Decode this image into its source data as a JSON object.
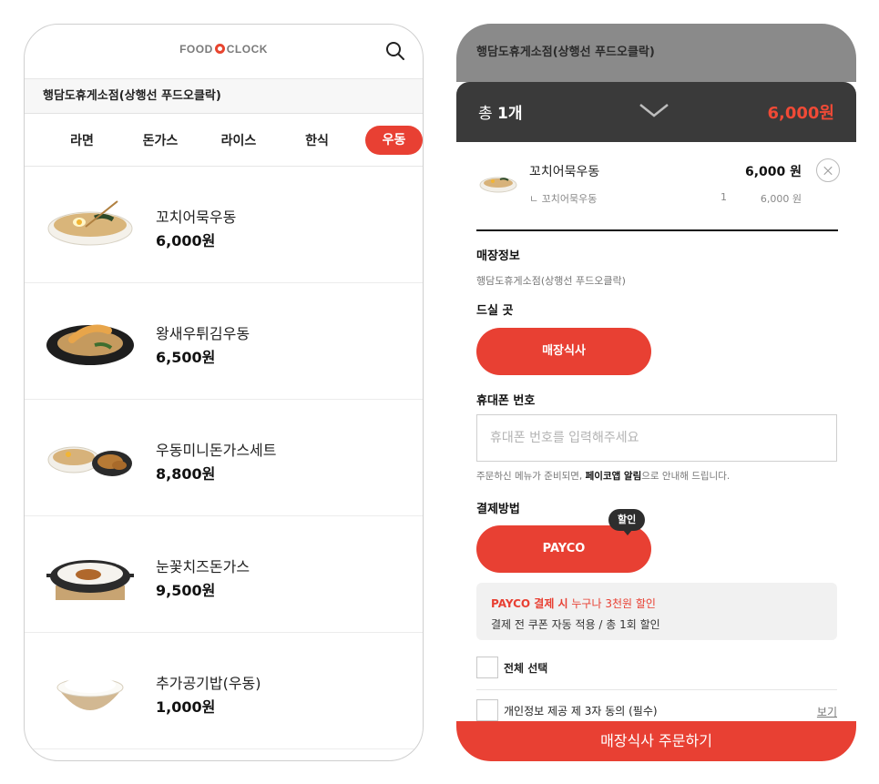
{
  "left": {
    "logo": {
      "left": "FOOD",
      "right": "CLOCK"
    },
    "store_name": "행담도휴게소점(상행선 푸드오클락)",
    "categories": [
      {
        "label": "라면"
      },
      {
        "label": "돈가스"
      },
      {
        "label": "라이스"
      },
      {
        "label": "한식"
      },
      {
        "label": "우동",
        "active": true
      }
    ],
    "menu": [
      {
        "name": "꼬치어묵우동",
        "price": "6,000원"
      },
      {
        "name": "왕새우튀김우동",
        "price": "6,500원"
      },
      {
        "name": "우동미니돈가스세트",
        "price": "8,800원"
      },
      {
        "name": "눈꽃치즈돈가스",
        "price": "9,500원"
      },
      {
        "name": "추가공기밥(우동)",
        "price": "1,000원"
      }
    ]
  },
  "right": {
    "store_name": "행담도휴게소점(상행선 푸드오클락)",
    "sheet": {
      "total_prefix": "총 ",
      "total_count": "1개",
      "total_price": "6,000원"
    },
    "cart_item": {
      "name": "꼬치어묵우동",
      "price": "6,000 원",
      "option": "ㄴ 꼬치어묵우동",
      "qty": "1",
      "option_price": "6,000 원"
    },
    "store_info_label": "매장정보",
    "store_info_value": "행담도휴게소점(상행선 푸드오클락)",
    "dine_label": "드실 곳",
    "dine_button": "매장식사",
    "phone_label": "휴대폰 번호",
    "phone_placeholder": "휴대폰 번호를 입력해주세요",
    "notice_pre": "주문하신 메뉴가 준비되면, ",
    "notice_bold": "페이코앱 알림",
    "notice_post": "으로 안내해 드립니다.",
    "payment_label": "결제방법",
    "payment_badge": "할인",
    "payment_button": "PAYCO",
    "promo_bold": "PAYCO 결제 시",
    "promo_rest": " 누구나 3천원 할인",
    "promo_line2": "결제 전 쿠폰 자동 적용 / 총 1회 할인",
    "select_all": "전체 선택",
    "consent": "개인정보 제공 제 3자 동의 (필수)",
    "view_link": "보기",
    "order_button": "매장식사 주문하기"
  },
  "colors": {
    "accent": "#e84033",
    "dark": "#3a3a3a"
  }
}
